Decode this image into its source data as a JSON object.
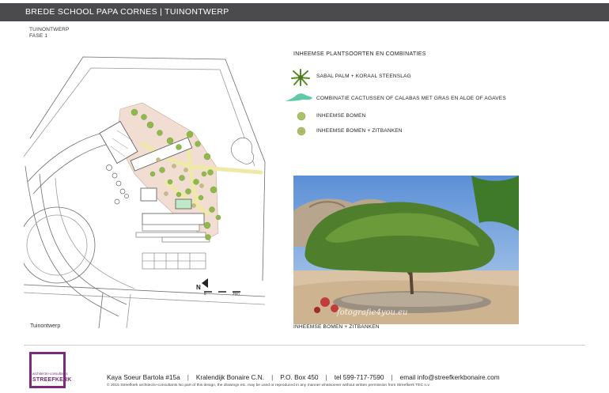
{
  "header": {
    "title": "BREDE SCHOOL PAPA CORNES | TUINONTWERP"
  },
  "subtitle": {
    "line1": "TUINONTWERP",
    "line2": "FASE 1"
  },
  "plan": {
    "caption": "Tuinontwerp",
    "north_label": "N",
    "scale_start": "0",
    "scale_end": "25m"
  },
  "legend": {
    "title": "INHEEMSE PLANTSOORTEN EN COMBINATIES",
    "items": [
      {
        "label": "SABAL PALM + KORAAL STEENSLAG",
        "icon": "palm-icon"
      },
      {
        "label": "COMBINATIE CACTUSSEN OF CALABAS MET GRAS EN ALOE OF AGAVES",
        "icon": "planting-bed-icon"
      },
      {
        "label": "INHEEMSE BOMEN",
        "icon": "tree-dot-icon"
      },
      {
        "label": "INHEEMSE BOMEN + ZITBANKEN",
        "icon": "tree-bench-icon"
      }
    ]
  },
  "photo": {
    "caption": "INHEEMSE BOMEN + ZITBANKEN",
    "watermark": "fotografie4you.eu"
  },
  "footer": {
    "logo_small": "architects+consultants",
    "logo_main": "STREEFKERK",
    "address": [
      "Kaya Soeur Bartola #15a",
      "Kralendijk Bonaire C.N.",
      "P.O. Box 450",
      "tel 599-717-7590",
      "email info@streefkerkbonaire.com"
    ],
    "copyright": "© 2015 Streefkerk architects+consultants   No part of this design, the drawings etc. may be used or reproduced in any manner whatsoever without written permission from  Streefkerk TEC n.v."
  },
  "colors": {
    "header_bg": "#4b4b4d",
    "planting_green": "#8fb94a",
    "path_yellow": "#efe9a8",
    "logo_purple": "#7a2b7a",
    "bed_mint": "#5fc9a8"
  }
}
